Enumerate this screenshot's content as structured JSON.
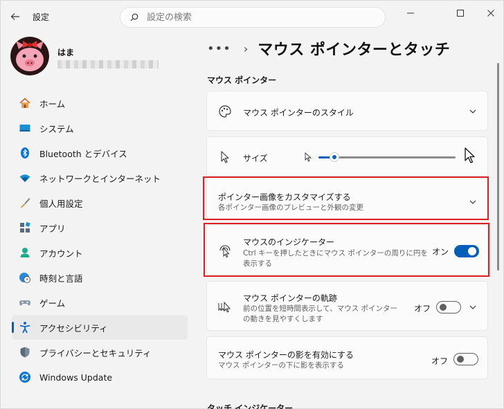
{
  "app": {
    "title": "設定"
  },
  "search": {
    "placeholder": "設定の検索"
  },
  "profile": {
    "name": "はま"
  },
  "sidebar": {
    "items": [
      {
        "label": "ホーム",
        "icon": "home-icon"
      },
      {
        "label": "システム",
        "icon": "system-icon"
      },
      {
        "label": "Bluetooth とデバイス",
        "icon": "bluetooth-icon"
      },
      {
        "label": "ネットワークとインターネット",
        "icon": "wifi-icon"
      },
      {
        "label": "個人用設定",
        "icon": "brush-icon"
      },
      {
        "label": "アプリ",
        "icon": "apps-icon"
      },
      {
        "label": "アカウント",
        "icon": "account-icon"
      },
      {
        "label": "時刻と言語",
        "icon": "globe-clock-icon"
      },
      {
        "label": "ゲーム",
        "icon": "gamepad-icon"
      },
      {
        "label": "アクセシビリティ",
        "icon": "accessibility-icon",
        "active": true
      },
      {
        "label": "プライバシーとセキュリティ",
        "icon": "shield-icon"
      },
      {
        "label": "Windows Update",
        "icon": "update-icon"
      }
    ]
  },
  "breadcrumb": {
    "more": "•••",
    "separator": "›",
    "title": "マウス ポインターとタッチ"
  },
  "sections": {
    "mouse_pointer": "マウス ポインター",
    "touch_indicator": "タッチ インジケーター"
  },
  "cards": {
    "style": {
      "title": "マウス ポインターのスタイル"
    },
    "size": {
      "title": "サイズ",
      "level": 0.06
    },
    "customize": {
      "title": "ポインター画像をカスタマイズする",
      "subtitle": "各ポインター画像のプレビューと外観の変更"
    },
    "indicator": {
      "title": "マウスのインジケーター",
      "subtitle": "Ctrl キーを押したときにマウス ポインターの周りに円を表示する",
      "state": "オン",
      "on": true
    },
    "trails": {
      "title": "マウス ポインターの軌跡",
      "subtitle": "前の位置を短時間表示して、マウス ポインターの動きを見やすくします",
      "state": "オフ",
      "on": false
    },
    "shadow": {
      "title": "マウス ポインターの影を有効にする",
      "subtitle": "マウス ポインターの下に影を表示する",
      "state": "オフ",
      "on": false
    }
  },
  "colors": {
    "accent": "#005fb8",
    "highlight": "#e02020"
  }
}
